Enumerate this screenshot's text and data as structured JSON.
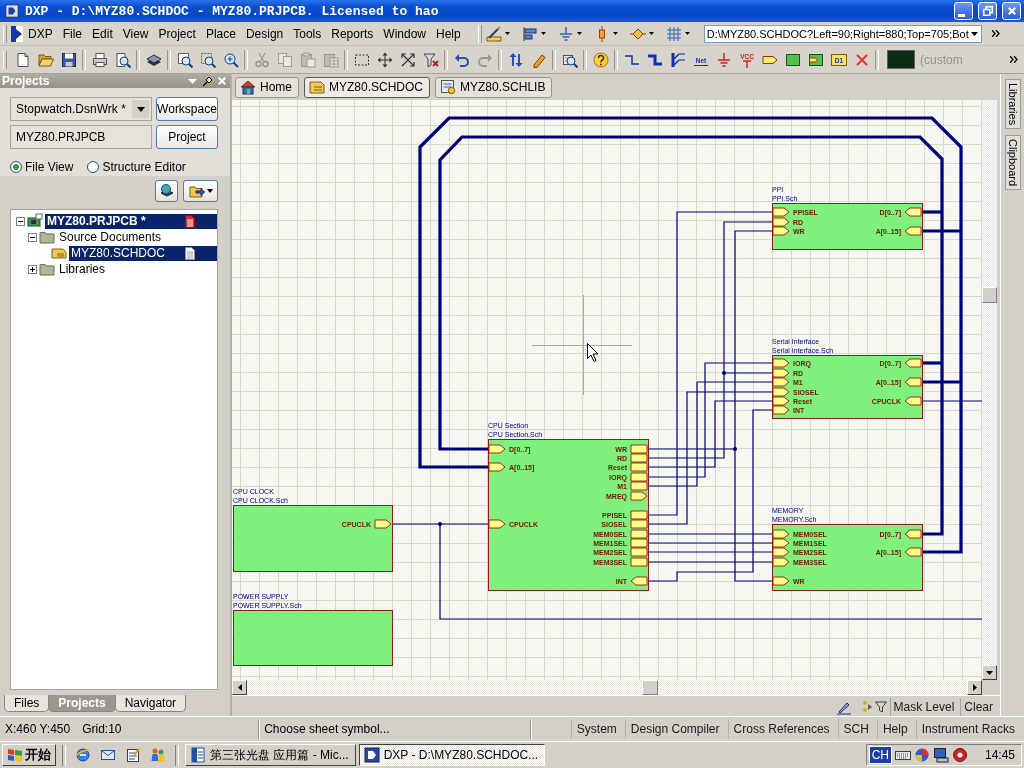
{
  "window": {
    "title": "DXP - D:\\MYZ80.SCHDOC - MYZ80.PRJPCB. Licensed to hao"
  },
  "menu_bar": [
    "DXP",
    "File",
    "Edit",
    "View",
    "Project",
    "Place",
    "Design",
    "Tools",
    "Reports",
    "Window",
    "Help"
  ],
  "wiring_tools": [
    {
      "kind": "drawing_tools"
    },
    {
      "kind": "alignment"
    },
    {
      "kind": "power_sources"
    },
    {
      "kind": "digital_devices"
    },
    {
      "kind": "simulation_sources"
    },
    {
      "kind": "grids"
    }
  ],
  "address_bar": {
    "value": "D:\\MYZ80.SCHDOC?Left=90;Right=880;Top=705;Bot"
  },
  "toolbar": [
    [
      {
        "kind": "new",
        "disabled": false
      },
      {
        "kind": "open",
        "disabled": false
      },
      {
        "kind": "save",
        "disabled": false
      }
    ],
    [
      {
        "kind": "print",
        "disabled": false
      },
      {
        "kind": "print_preview",
        "disabled": false
      }
    ],
    [
      {
        "kind": "layers",
        "disabled": false
      }
    ],
    [
      {
        "kind": "zoom_fit",
        "disabled": false
      },
      {
        "kind": "zoom_area",
        "disabled": false
      },
      {
        "kind": "zoom_selected",
        "disabled": false
      }
    ],
    [
      {
        "kind": "cut",
        "disabled": true
      },
      {
        "kind": "copy",
        "disabled": true
      },
      {
        "kind": "paste",
        "disabled": true
      },
      {
        "kind": "paste_array",
        "disabled": true
      }
    ],
    [
      {
        "kind": "select_area",
        "disabled": false
      },
      {
        "kind": "move",
        "disabled": false
      },
      {
        "kind": "deselect",
        "disabled": false
      },
      {
        "kind": "clear_filter",
        "disabled": false
      }
    ],
    [
      {
        "kind": "undo",
        "disabled": false
      },
      {
        "kind": "redo",
        "disabled": true
      }
    ],
    [
      {
        "kind": "cross_probe",
        "disabled": false
      },
      {
        "kind": "highlight",
        "disabled": false
      }
    ],
    [
      {
        "kind": "browse",
        "disabled": false
      }
    ],
    [
      {
        "kind": "help",
        "disabled": false
      }
    ],
    [
      {
        "kind": "wire",
        "disabled": false
      },
      {
        "kind": "bus",
        "disabled": false
      },
      {
        "kind": "bus_entry",
        "disabled": false
      },
      {
        "kind": "net_label",
        "disabled": false,
        "text": "Net"
      },
      {
        "kind": "ground",
        "disabled": false
      },
      {
        "kind": "power_port",
        "disabled": false,
        "text": "VCC"
      },
      {
        "kind": "port",
        "disabled": false
      },
      {
        "kind": "sheet_symbol",
        "disabled": false
      },
      {
        "kind": "sheet_entry",
        "disabled": false
      },
      {
        "kind": "device_sheet",
        "disabled": false,
        "text": "D1"
      },
      {
        "kind": "no_erc",
        "disabled": false
      }
    ]
  ],
  "color_box": {
    "label": "(custom"
  },
  "projects_panel": {
    "title": "Projects",
    "workspace": {
      "value": "Stopwatch.DsnWrk *"
    },
    "workspace_button": "Workspace",
    "project": {
      "value": "MYZ80.PRJPCB"
    },
    "project_button": "Project",
    "view_options": [
      {
        "label": "File View",
        "selected": true
      },
      {
        "label": "Structure Editor",
        "selected": false
      }
    ],
    "tree": [
      {
        "label": "MYZ80.PRJPCB *",
        "kind": "project",
        "selected": true,
        "expanded": true,
        "modified": true,
        "children": [
          {
            "label": "Source Documents",
            "kind": "folder",
            "selected": false,
            "expanded": true,
            "children": [
              {
                "label": "MYZ80.SCHDOC",
                "kind": "schematic",
                "selected": true,
                "modified": false
              }
            ]
          },
          {
            "label": "Libraries",
            "kind": "folder",
            "selected": false,
            "expanded": false
          }
        ]
      }
    ],
    "tabs": [
      {
        "label": "Files",
        "selected": false
      },
      {
        "label": "Projects",
        "selected": true
      },
      {
        "label": "Navigator",
        "selected": false
      }
    ]
  },
  "document_tabs": [
    {
      "label": "Home",
      "kind": "home",
      "selected": false
    },
    {
      "label": "MYZ80.SCHDOC",
      "kind": "schematic",
      "selected": true
    },
    {
      "label": "MYZ80.SCHLIB",
      "kind": "library",
      "selected": false
    }
  ],
  "schematic": {
    "sheets": [
      {
        "designator": "PPI",
        "filename": "PPI.Sch",
        "left_entries": [
          {
            "name": "PPISEL",
            "kind": "input"
          },
          {
            "name": "RD",
            "kind": "input"
          },
          {
            "name": "WR",
            "kind": "input"
          }
        ],
        "right_entries": [
          {
            "name": "D[0..7]",
            "kind": "input"
          },
          {
            "name": "A[0..15]",
            "kind": "input"
          }
        ]
      },
      {
        "designator": "Serial Interface",
        "filename": "Serial Interface.Sch",
        "left_entries": [
          {
            "name": "IORQ",
            "kind": "input"
          },
          {
            "name": "RD",
            "kind": "input"
          },
          {
            "name": "M1",
            "kind": "input"
          },
          {
            "name": "SIOSEL",
            "kind": "input"
          },
          {
            "name": "Reset",
            "kind": "input"
          },
          {
            "name": "INT",
            "kind": "input"
          }
        ],
        "right_entries": [
          {
            "name": "D[0..7]",
            "kind": "input"
          },
          {
            "name": "A[0..15]",
            "kind": "input"
          },
          {
            "name": "CPUCLK",
            "kind": "input"
          }
        ]
      },
      {
        "designator": "CPU Section",
        "filename": "CPU Section.Sch",
        "left_entries": [
          {
            "name": "D[0..7]",
            "kind": "input"
          },
          {
            "name": "A[0..15]",
            "kind": "input"
          },
          {
            "name": "CPUCLK",
            "kind": "input"
          }
        ],
        "right_entries": [
          {
            "name": "WR",
            "kind": "unspecified"
          },
          {
            "name": "RD",
            "kind": "unspecified"
          },
          {
            "name": "Reset",
            "kind": "unspecified"
          },
          {
            "name": "IORQ",
            "kind": "unspecified"
          },
          {
            "name": "M1",
            "kind": "unspecified"
          },
          {
            "name": "MREQ",
            "kind": "output"
          },
          {
            "name": "PPISEL",
            "kind": "unspecified"
          },
          {
            "name": "SIOSEL",
            "kind": "unspecified"
          },
          {
            "name": "MEM0SEL",
            "kind": "unspecified"
          },
          {
            "name": "MEM1SEL",
            "kind": "unspecified"
          },
          {
            "name": "MEM2SEL",
            "kind": "unspecified"
          },
          {
            "name": "MEM3SEL",
            "kind": "unspecified"
          },
          {
            "name": "INT",
            "kind": "input"
          }
        ]
      },
      {
        "designator": "CPU CLOCK",
        "filename": "CPU CLOCK.Sch",
        "right_entries": [
          {
            "name": "CPUCLK",
            "kind": "output"
          }
        ]
      },
      {
        "designator": "MEMORY",
        "filename": "MEMORY.Sch",
        "left_entries": [
          {
            "name": "MEM0SEL",
            "kind": "input"
          },
          {
            "name": "MEM1SEL",
            "kind": "input"
          },
          {
            "name": "MEM2SEL",
            "kind": "input"
          },
          {
            "name": "MEM3SEL",
            "kind": "input"
          },
          {
            "name": "WR",
            "kind": "input"
          }
        ],
        "right_entries": [
          {
            "name": "D[0..7]",
            "kind": "input"
          },
          {
            "name": "A[0..15]",
            "kind": "input"
          }
        ]
      },
      {
        "designator": "POWER SUPPLY",
        "filename": "POWER SUPPLY.Sch"
      }
    ]
  },
  "side_panel_tabs": [
    "Libraries",
    "Clipboard"
  ],
  "mask_bar": {
    "mask_level": "Mask Level",
    "clear": "Clear"
  },
  "status_bar": {
    "coordinates": "X:460 Y:450",
    "grid": "Grid:10",
    "message": "Choose sheet symbol...",
    "panels": [
      "System",
      "Design Compiler",
      "Cross References",
      "SCH",
      "Help",
      "Instrument Racks"
    ]
  },
  "taskbar": {
    "start": "开始",
    "tasks": [
      {
        "label": "第三张光盘 应用篇 - Mic...",
        "kind": "document",
        "selected": false
      },
      {
        "label": "DXP - D:\\MYZ80.SCHDOC...",
        "kind": "app",
        "selected": true
      }
    ],
    "language": "CH",
    "clock": "14:45"
  }
}
